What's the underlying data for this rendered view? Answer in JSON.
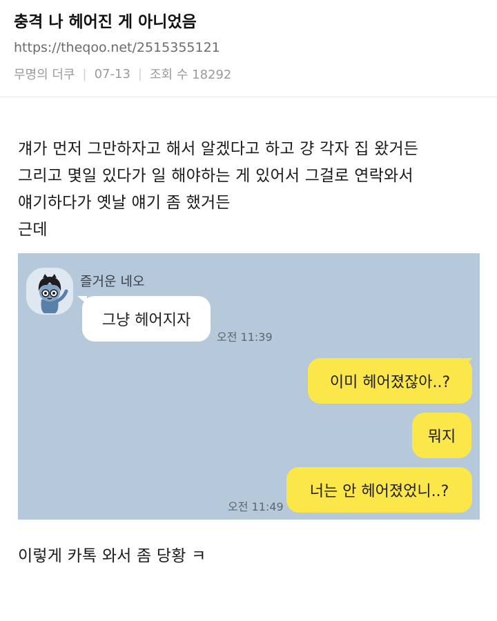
{
  "post": {
    "title": "충격 나 헤어진 게 아니었음",
    "url": "https://theqoo.net/2515355121",
    "author": "무명의 더쿠",
    "date": "07-13",
    "views_label": "조회 수 18292",
    "separator": "|"
  },
  "body": {
    "lines": [
      "걔가 먼저 그만하자고 해서 알겠다고 하고 걍 각자 집 왔거든",
      "그리고 몇일 있다가 일 해야하는 게 있어서 그걸로 연락와서",
      "얘기하다가 옛날 얘기 좀 했거든",
      "근데"
    ],
    "closing": "이렇게 카톡 와서 좀 당황 ㅋ"
  },
  "chat": {
    "background": "#b5c9da",
    "sender_name": "즐거운 네오",
    "avatar_icon": "neo-character-avatar-icon",
    "colors": {
      "incoming_bubble": "#ffffff",
      "outgoing_bubble": "#fbe74a"
    },
    "messages": [
      {
        "side": "left",
        "text": "그냥 헤어지자",
        "time": "오전 11:39"
      },
      {
        "side": "right",
        "text": "이미 헤어졌잖아..?"
      },
      {
        "side": "right",
        "text": "뭐지"
      },
      {
        "side": "right",
        "text": "너는 안 헤어졌었니..?",
        "time": "오전 11:49"
      }
    ]
  }
}
